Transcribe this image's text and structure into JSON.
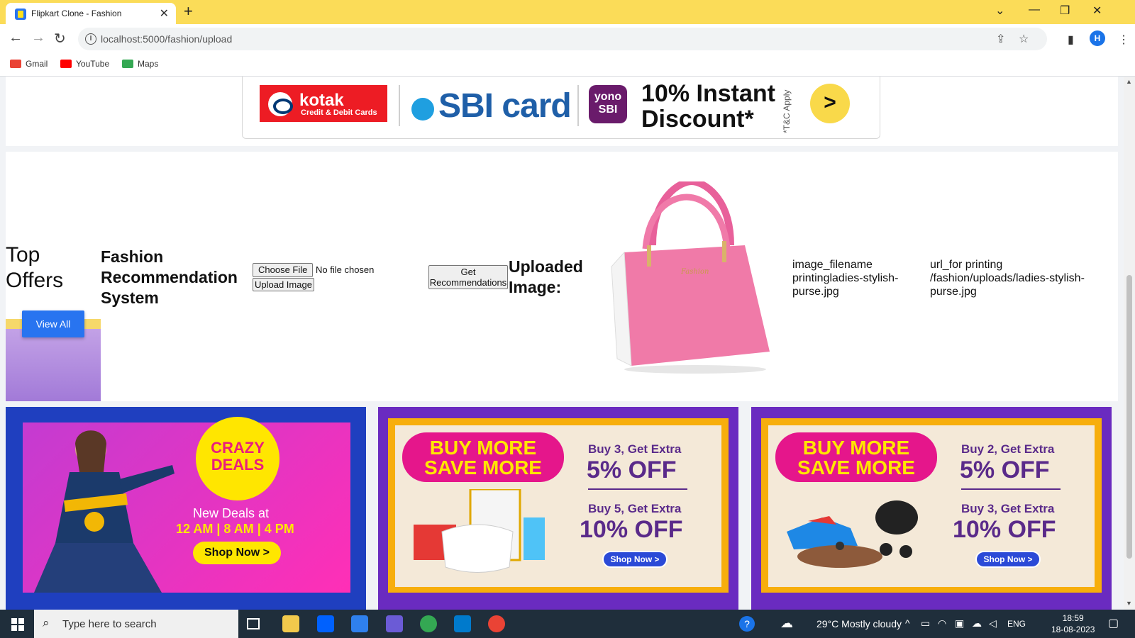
{
  "browser": {
    "tab_title": "Flipkart Clone - Fashion",
    "url": "localhost:5000/fashion/upload",
    "profile_initial": "H",
    "bookmarks": [
      {
        "label": "Gmail",
        "icon": "gmail-icon",
        "color": "#ea4335"
      },
      {
        "label": "YouTube",
        "icon": "youtube-icon",
        "color": "#ff0000"
      },
      {
        "label": "Maps",
        "icon": "maps-icon",
        "color": "#34a853"
      }
    ]
  },
  "banner": {
    "kotak_name": "kotak",
    "kotak_sub": "Credit & Debit Cards",
    "sbi_text": "SBI card",
    "yono_text": "yono SBI",
    "discount_line1": "10% Instant",
    "discount_line2": "Discount*",
    "tc": "*T&C Apply",
    "arrow": ">"
  },
  "offers": {
    "title_line1": "Top",
    "title_line2": "Offers",
    "view_all": "View All"
  },
  "recommendation": {
    "title_line1": "Fashion",
    "title_line2": "Recommendation",
    "title_line3": "System",
    "choose_file": "Choose File",
    "no_file": "No file chosen",
    "upload_button": "Upload Image",
    "get_rec_line1": "Get",
    "get_rec_line2": "Recommendations",
    "uploaded_line1": "Uploaded",
    "uploaded_line2": "Image:",
    "filename_text": "image_filename printingladies-stylish-purse.jpg",
    "url_text": "url_for printing /fashion/uploads/ladies-stylish-purse.jpg"
  },
  "cards": {
    "crazy_line1": "CRAZY",
    "crazy_line2": "DEALS",
    "new_deals": "New Deals at",
    "times": "12 AM | 8 AM | 4 PM",
    "shop_now": "Shop Now >",
    "bms_line1": "BUY MORE",
    "bms_line2": "SAVE MORE",
    "card2": {
      "a": "Buy 3, Get Extra",
      "b": "5% OFF",
      "c": "Buy 5, Get Extra",
      "d": "10% OFF",
      "shop": "Shop Now >"
    },
    "card3": {
      "a": "Buy 2, Get Extra",
      "b": "5% OFF",
      "c": "Buy 3, Get Extra",
      "d": "10% OFF",
      "shop": "Shop Now >"
    }
  },
  "taskbar": {
    "search_placeholder": "Type here to search",
    "weather": "29°C  Mostly cloudy",
    "lang": "ENG",
    "time": "18:59",
    "date": "18-08-2023"
  },
  "colors": {
    "flipkart_blue": "#2874f0",
    "chrome_yellow": "#fbdc58",
    "bag_pink": "#f27aa8"
  }
}
